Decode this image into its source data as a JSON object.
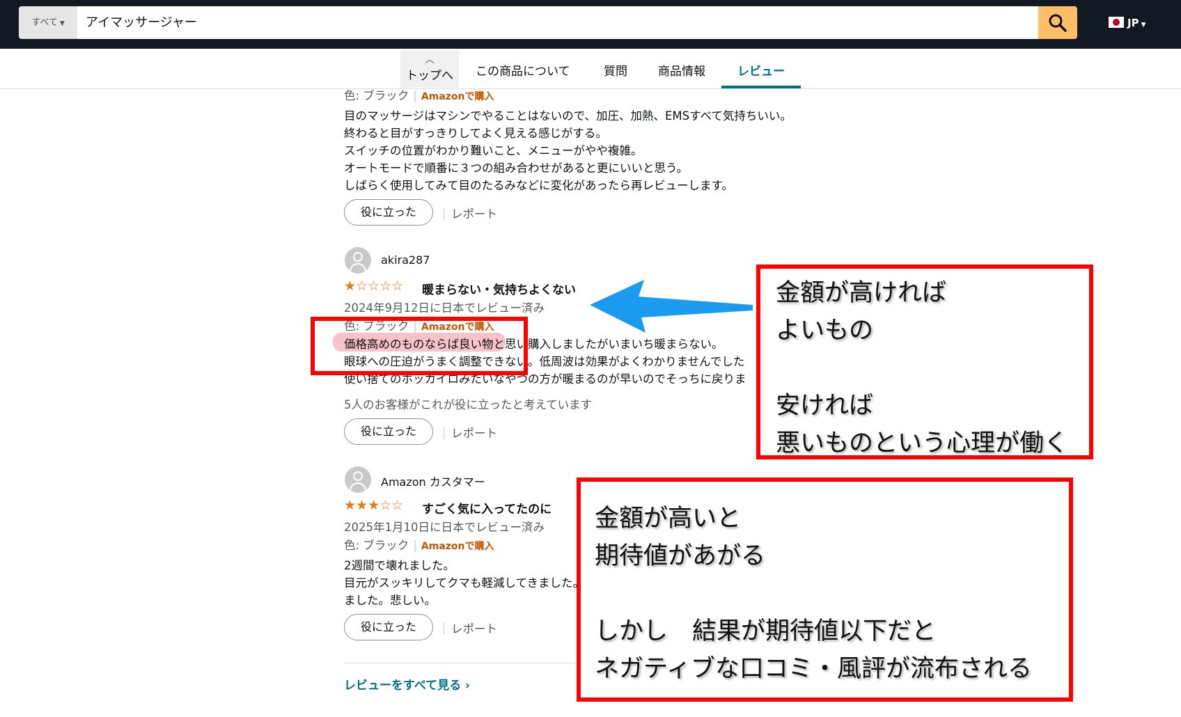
{
  "search": {
    "category_label": "すべて",
    "query": "アイマッサージャー",
    "locale": "JP"
  },
  "subnav": {
    "to_top": "トップへ",
    "tabs": [
      "この商品について",
      "質問",
      "商品情報",
      "レビュー"
    ]
  },
  "review_prev": {
    "meta_color": "色: ブラック",
    "meta_purchase": "Amazonで購入",
    "body": [
      "目のマッサージはマシンでやることはないので、加圧、加熱、EMSすべて気持ちいい。",
      "終わると目がすっきりしてよく見える感じがする。",
      "スイッチの位置がわかり難いこと、メニューがやや複雑。",
      "オートモードで順番に３つの組み合わせがあると更にいいと思う。",
      "しばらく使用してみて目のたるみなどに変化があったら再レビューします。"
    ],
    "helpful": "役に立った",
    "report": "レポート"
  },
  "review_akira": {
    "user": "akira287",
    "rating": 1,
    "title": "暖まらない・気持ちよくない",
    "date": "2024年9月12日に日本でレビュー済み",
    "meta_color": "色: ブラック",
    "meta_purchase": "Amazonで購入",
    "body": [
      "価格高めのものならば良い物と思い購入しましたがいまいち暖まらない。",
      "眼球への圧迫がうまく調整できない。低周波は効果がよくわかりませんでした",
      "使い捨てのホッカイロみたいなやつの方が暖まるのが早いのでそっちに戻りま"
    ],
    "helpful_count": "5人のお客様がこれが役に立ったと考えています",
    "helpful": "役に立った",
    "report": "レポート"
  },
  "review_customer": {
    "user": "Amazon カスタマー",
    "rating": 3,
    "title": "すごく気に入ってたのに",
    "date": "2025年1月10日に日本でレビュー済み",
    "meta_color": "色: ブラック",
    "meta_purchase": "Amazonで購入",
    "body": [
      "2週間で壊れました。",
      "目元がスッキリしてクマも軽減してきました。寝る前につけて寝落ちしちゃうほど気持ちいいですが、壊れ",
      "ました。悲しい。"
    ],
    "helpful": "役に立った",
    "report": "レポート"
  },
  "see_all": "レビューをすべて見る ›",
  "annotation_1": {
    "lines": [
      "金額が高ければ",
      "よいもの",
      "",
      "安ければ",
      "悪いものという心理が働く"
    ]
  },
  "annotation_2": {
    "lines": [
      "金額が高いと",
      "期待値があがる",
      "",
      "しかし　結果が期待値以下だと",
      "ネガティブな口コミ・風評が流布される"
    ]
  },
  "colors": {
    "header_bg": "#131921",
    "search_button": "#febd69",
    "link_teal": "#007185",
    "star_orange": "#e47911",
    "annotation_red": "#ff0000",
    "arrow_blue": "#1a9bf0",
    "highlight_pink": "#eb788c"
  }
}
